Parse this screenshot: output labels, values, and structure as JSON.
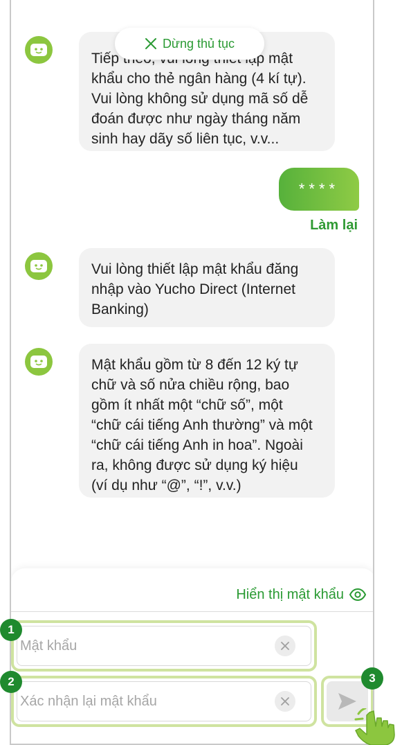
{
  "header": {
    "stop_label": "Dừng thủ tục"
  },
  "messages": [
    {
      "text": "Tiếp theo, vui lòng thiết lập mật\nkhẩu cho thẻ ngân hàng (4 kí tự).\nVui lòng không sử dụng mã số dễ\nđoán được như ngày tháng năm\nsinh hay dãy số liên tục, v.v..."
    },
    {
      "text": "Vui lòng thiết lập mật khẩu đăng\nnhập vào Yucho Direct (Internet\nBanking)"
    },
    {
      "text": "Mật khẩu gồm từ 8 đến 12 ký tự\nchữ và số nửa chiều rộng, bao\ngồm ít nhất một “chữ số”, một\n“chữ cái tiếng Anh thường” và một\n“chữ cái tiếng Anh in hoa”. Ngoài\nra, không được sử dụng ký hiệu\n(ví dụ như “@”, “!”, v.v.)"
    }
  ],
  "user_reply": {
    "text": "****",
    "redo_label": "Làm lại"
  },
  "input_panel": {
    "show_password_label": "Hiển thị mật khẩu",
    "password_placeholder": "Mật khẩu",
    "confirm_placeholder": "Xác nhận lại mật khẩu"
  },
  "steps": {
    "one": "1",
    "two": "2",
    "three": "3"
  },
  "colors": {
    "accent": "#2a9a33",
    "bot_avatar": "#8cc63f",
    "highlight": "#cfe3a0",
    "badge": "#1f8a2e"
  },
  "icons": {
    "stop": "close-icon",
    "bot": "bot-face-icon",
    "show_password": "eye-icon",
    "clear": "clear-icon",
    "send": "send-icon",
    "hand": "hand-pointer-icon"
  }
}
